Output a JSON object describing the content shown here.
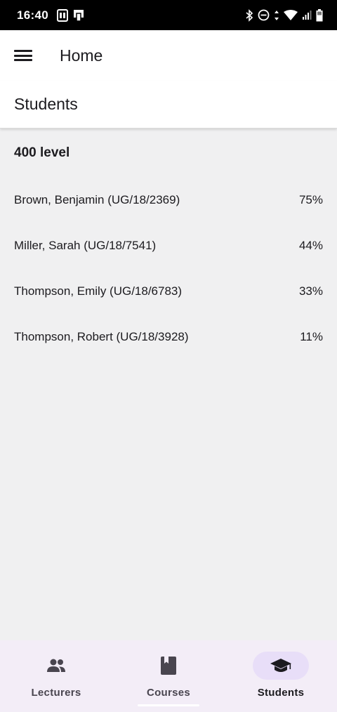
{
  "status_bar": {
    "time": "16:40"
  },
  "app_bar": {
    "title": "Home"
  },
  "section": {
    "title": "Students"
  },
  "group": {
    "title": "400 level"
  },
  "students": [
    {
      "name": "Brown, Benjamin (UG/18/2369)",
      "score": "75%"
    },
    {
      "name": "Miller, Sarah (UG/18/7541)",
      "score": "44%"
    },
    {
      "name": "Thompson, Emily (UG/18/6783)",
      "score": "33%"
    },
    {
      "name": "Thompson, Robert (UG/18/3928)",
      "score": "11%"
    }
  ],
  "bottom_nav": {
    "items": [
      {
        "label": "Lecturers",
        "icon": "people-icon"
      },
      {
        "label": "Courses",
        "icon": "book-icon"
      },
      {
        "label": "Students",
        "icon": "graduation-cap-icon",
        "active": true
      }
    ]
  },
  "colors": {
    "background": "#f0f0f1",
    "nav_background": "#f3edf7",
    "active_indicator": "#e8def8",
    "text": "#1c1b1f"
  }
}
